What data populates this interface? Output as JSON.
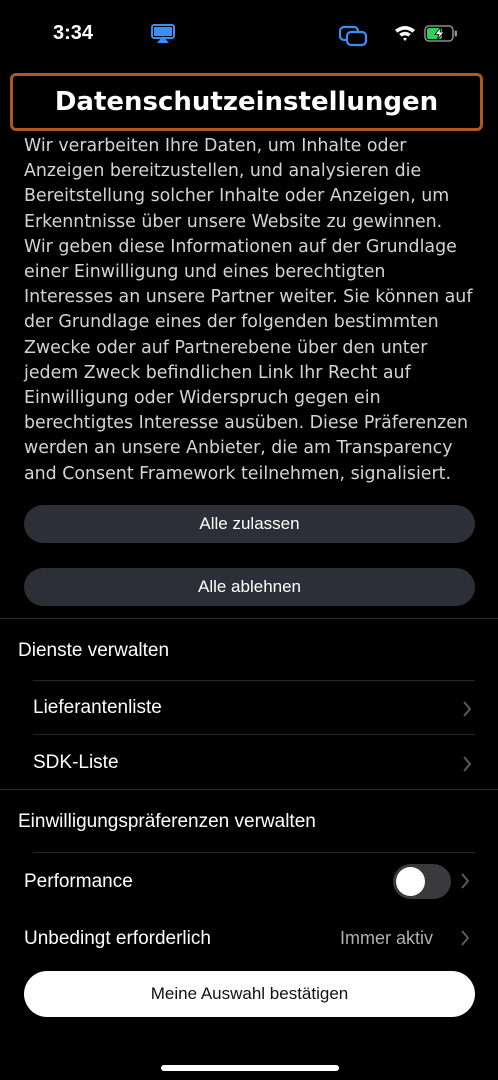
{
  "status_bar": {
    "time": "3:34",
    "icons": [
      "airplay-icon",
      "screen-mirroring-icon",
      "wifi-icon",
      "battery-charging-icon"
    ],
    "accent_color": "#3a8ff7",
    "battery_color": "#30d158"
  },
  "header": {
    "title": "Datenschutzeinstellungen"
  },
  "description": "Wir verarbeiten Ihre Daten, um Inhalte oder\nAnzeigen bereitzustellen, und analysieren die\nBereitstellung solcher Inhalte oder Anzeigen, um\nErkenntnisse über unsere Website zu gewinnen.\nWir geben diese Informationen auf der Grundlage\neiner Einwilligung und eines berechtigten\nInteresses an unsere Partner weiter. Sie können auf\nder Grundlage eines der folgenden bestimmten\nZwecke oder auf Partnerebene über den unter\njedem Zweck befindlichen Link Ihr Recht auf\nEinwilligung oder Widerspruch gegen ein\nberechtigtes Interesse ausüben. Diese Präferenzen\nwerden an unsere Anbieter, die am Transparency\nand Consent Framework teilnehmen, signalisiert.",
  "buttons": {
    "allow_all": "Alle zulassen",
    "reject_all": "Alle ablehnen",
    "confirm": "Meine Auswahl bestätigen"
  },
  "manage_services": {
    "heading": "Dienste verwalten",
    "items": [
      {
        "label": "Lieferantenliste"
      },
      {
        "label": "SDK-Liste"
      }
    ]
  },
  "consent_prefs": {
    "heading": "Einwilligungspräferenzen verwalten",
    "items": [
      {
        "label": "Performance",
        "toggle_on": false
      },
      {
        "label": "Unbedingt erforderlich",
        "status": "Immer aktiv"
      }
    ]
  }
}
